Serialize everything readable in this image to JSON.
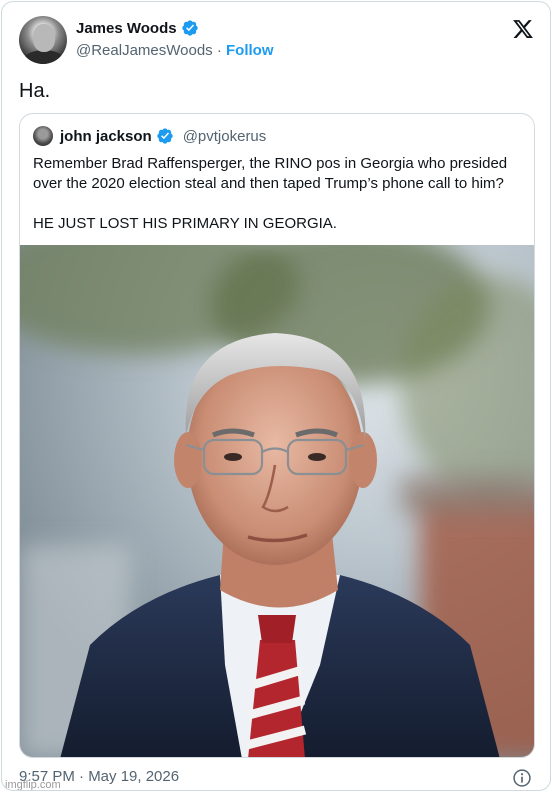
{
  "author": {
    "name": "James Woods",
    "handle": "@RealJamesWoods",
    "separator": "·",
    "follow_label": "Follow",
    "avatar_icon": "avatar-photo"
  },
  "tweet": {
    "text": "Ha."
  },
  "quoted": {
    "name": "john jackson",
    "handle": "@pvtjokerus",
    "lines": [
      "Remember Brad Raffensperger, the RINO pos in Georgia who presided",
      "over the 2020 election steal and then taped Trump’s phone call to him?"
    ],
    "line2": "HE JUST LOST HIS PRIMARY IN GEORGIA."
  },
  "footer": {
    "timestamp": "9:57 PM · May 19, 2026"
  },
  "watermark": "imgflip.com",
  "colors": {
    "link": "#1d9bf0",
    "verified": "#1d9bf0",
    "muted": "#536471",
    "border": "#cfd9de"
  }
}
